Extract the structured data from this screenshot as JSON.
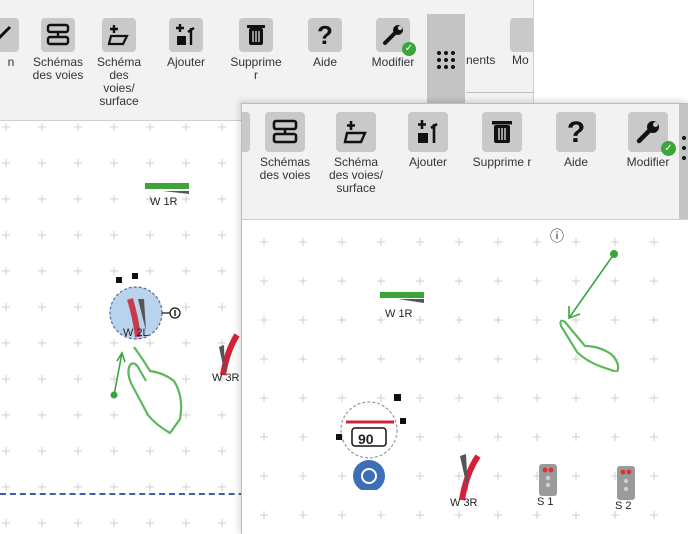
{
  "back": {
    "toolbar": {
      "partial_left": "n",
      "items": [
        {
          "label": "Schémas des voies"
        },
        {
          "label": "Schéma des voies/ surface"
        },
        {
          "label": "Ajouter"
        },
        {
          "label": "Supprime r"
        },
        {
          "label": "Aide"
        },
        {
          "label": "Modifier"
        }
      ],
      "partial_right_1": "nents",
      "partial_right_2": "Mo"
    },
    "canvas": {
      "turnout_top": "W 1R",
      "turnout_mid": "W 2L",
      "turnout_right": "W 3R",
      "info_symbol": "ⓘ"
    }
  },
  "front": {
    "toolbar": {
      "items": [
        {
          "label": "Schémas des voies"
        },
        {
          "label": "Schéma des voies/ surface"
        },
        {
          "label": "Ajouter"
        },
        {
          "label": "Supprime r"
        },
        {
          "label": "Aide"
        },
        {
          "label": "Modifier"
        }
      ]
    },
    "canvas": {
      "info_symbol": "ⓘ",
      "turnout_top": "W 1R",
      "speed_value": "90",
      "turnout_bottom": "W 3R",
      "signal_1": "S 1",
      "signal_2": "S 2"
    }
  },
  "colors": {
    "accent_green": "#3aa63a",
    "track_red": "#d6203a",
    "loco_blue": "#3b6fb8",
    "hand_green": "#5db85b"
  }
}
